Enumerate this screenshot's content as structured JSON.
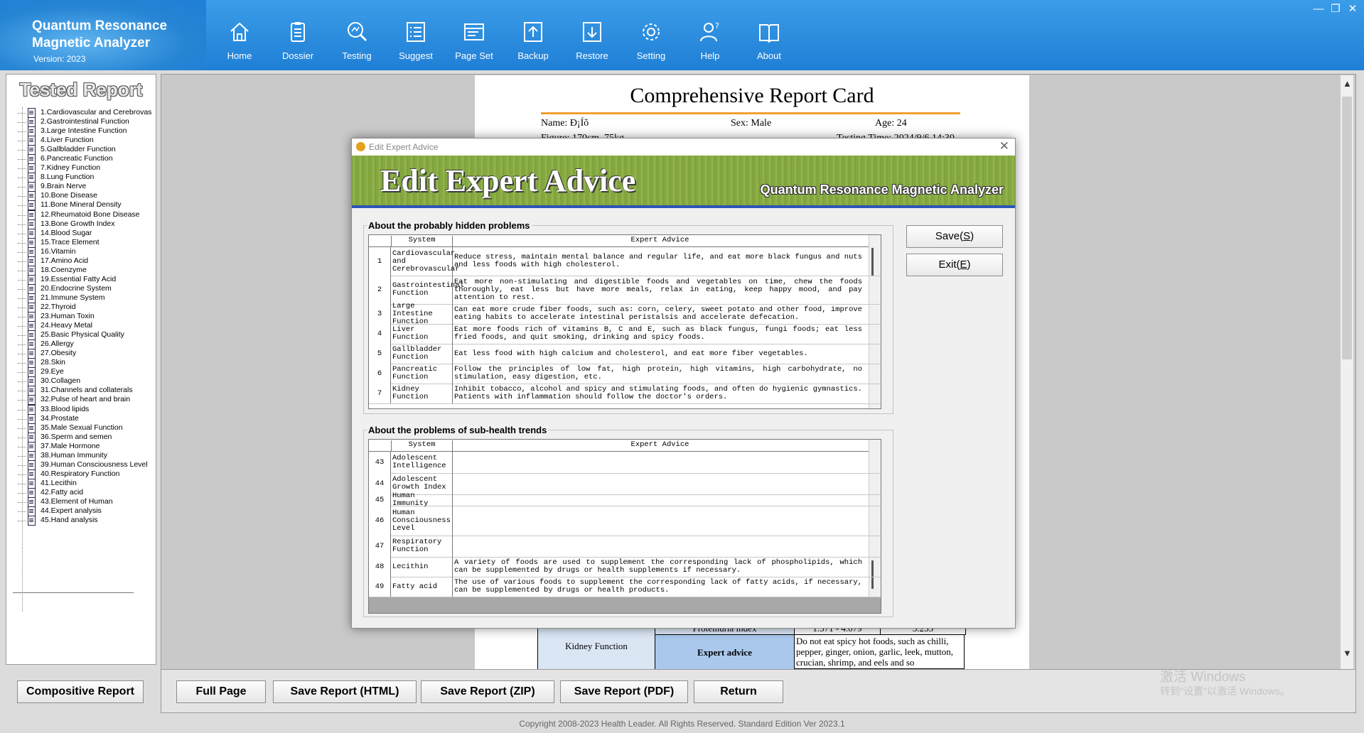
{
  "app": {
    "name_line1": "Quantum Resonance",
    "name_line2": "Magnetic Analyzer",
    "version": "Version: 2023"
  },
  "window_controls": {
    "minimize": "—",
    "restore": "❐",
    "close": "✕"
  },
  "nav": [
    {
      "label": "Home",
      "icon": "home-icon"
    },
    {
      "label": "Dossier",
      "icon": "dossier-icon"
    },
    {
      "label": "Testing",
      "icon": "testing-icon"
    },
    {
      "label": "Suggest",
      "icon": "suggest-icon"
    },
    {
      "label": "Page Set",
      "icon": "page-set-icon"
    },
    {
      "label": "Backup",
      "icon": "backup-icon"
    },
    {
      "label": "Restore",
      "icon": "restore-icon"
    },
    {
      "label": "Setting",
      "icon": "gear-icon"
    },
    {
      "label": "Help",
      "icon": "help-icon"
    },
    {
      "label": "About",
      "icon": "book-icon"
    }
  ],
  "sidebar": {
    "title": "Tested Report",
    "items": [
      "1.Cardiovascular and Cerebrovas",
      "2.Gastrointestinal Function",
      "3.Large Intestine Function",
      "4.Liver Function",
      "5.Gallbladder Function",
      "6.Pancreatic Function",
      "7.Kidney Function",
      "8.Lung Function",
      "9.Brain Nerve",
      "10.Bone Disease",
      "11.Bone Mineral Density",
      "12.Rheumatoid Bone Disease",
      "13.Bone Growth Index",
      "14.Blood Sugar",
      "15.Trace Element",
      "16.Vitamin",
      "17.Amino Acid",
      "18.Coenzyme",
      "19.Essential Fatty Acid",
      "20.Endocrine System",
      "21.Immune System",
      "22.Thyroid",
      "23.Human Toxin",
      "24.Heavy Metal",
      "25.Basic Physical Quality",
      "26.Allergy",
      "27.Obesity",
      "28.Skin",
      "29.Eye",
      "30.Collagen",
      "31.Channels and collaterals",
      "32.Pulse of heart and brain",
      "33.Blood lipids",
      "34.Prostate",
      "35.Male Sexual Function",
      "36.Sperm and semen",
      "37.Male Hormone",
      "38.Human Immunity",
      "39.Human Consciousness Level",
      "40.Respiratory Function",
      "41.Lecithin",
      "42.Fatty acid",
      "43.Element of Human",
      "44.Expert analysis",
      "45.Hand analysis"
    ],
    "composite_button": "Compositive Report"
  },
  "report": {
    "title": "Comprehensive Report Card",
    "name": "Name: Đ¡Íõ",
    "sex": "Sex: Male",
    "age": "Age: 24",
    "figure": "Figure: 170cm, 75kg",
    "testing_time": "Testing Time: 2024/9/6 14:30",
    "kidney": {
      "system": "Kidney Function",
      "row_label": "Proteinuria index",
      "range": "1.571 - 4.079",
      "value": "3.255",
      "expert_label": "Expert advice",
      "expert_text": "Do not eat spicy hot foods, such as chilli, pepper, ginger, onion, garlic, leek, mutton, crucian, shrimp, and eels and so"
    }
  },
  "bottom_buttons": [
    "Full Page",
    "Save Report (HTML)",
    "Save Report (ZIP)",
    "Save Report (PDF)",
    "Return"
  ],
  "copyright": "Copyright 2008-2023 Health Leader. All Rights Reserved.  Standard Edition Ver 2023.1",
  "watermark": {
    "line1": "激活 Windows",
    "line2": "转到\"设置\"以激活 Windows。"
  },
  "dialog": {
    "title": "Edit Expert Advice",
    "banner_title": "Edit Expert Advice",
    "banner_subtitle": "Quantum Resonance Magnetic Analyzer",
    "save_label": "Save(",
    "save_key": "S",
    "exit_label": "Exit(",
    "exit_key": "E",
    "close_paren": ")",
    "group1": {
      "title": "About the probably hidden problems",
      "col_system": "System",
      "col_advice": "Expert Advice",
      "rows": [
        {
          "n": "1",
          "system": "Cardiovascular and Cerebrovascular",
          "advice": "Reduce stress, maintain mental balance and regular life, and eat more black fungus and nuts and less foods with high cholesterol."
        },
        {
          "n": "2",
          "system": "Gastrointestinal Function",
          "advice": "Eat more non-stimulating and digestible foods and vegetables on time, chew the foods thoroughly, eat less but have more meals, relax in eating, keep happy mood, and pay attention to rest."
        },
        {
          "n": "3",
          "system": "Large Intestine Function",
          "advice": "Can eat more crude fiber foods, such as: corn, celery, sweet potato and other food, improve eating habits to accelerate intestinal peristalsis and accelerate defecation."
        },
        {
          "n": "4",
          "system": "Liver Function",
          "advice": "Eat more foods rich of vitamins B, C and E, such as black fungus, fungi foods; eat less fried foods, and quit smoking, drinking and spicy foods."
        },
        {
          "n": "5",
          "system": "Gallbladder Function",
          "advice": "Eat less food with high calcium and cholesterol, and eat more fiber vegetables."
        },
        {
          "n": "6",
          "system": "Pancreatic Function",
          "advice": "Follow the principles of low fat, high protein, high vitamins, high carbohydrate, no stimulation, easy digestion, etc."
        },
        {
          "n": "7",
          "system": "Kidney Function",
          "advice": "Inhibit tobacco, alcohol and spicy and stimulating foods, and often do hygienic gymnastics. Patients with inflammation should follow the doctor's orders."
        }
      ]
    },
    "group2": {
      "title": "About the problems of sub-health trends",
      "col_system": "System",
      "col_advice": "Expert Advice",
      "rows": [
        {
          "n": "43",
          "system": "Adolescent Intelligence",
          "advice": ""
        },
        {
          "n": "44",
          "system": "Adolescent Growth Index",
          "advice": ""
        },
        {
          "n": "45",
          "system": "Human Immunity",
          "advice": ""
        },
        {
          "n": "46",
          "system": "Human Consciousness Level",
          "advice": ""
        },
        {
          "n": "47",
          "system": "Respiratory Function",
          "advice": ""
        },
        {
          "n": "48",
          "system": "Lecithin",
          "advice": "A variety of foods are used to supplement the corresponding lack of phospholipids, which can be supplemented by drugs or health supplements if necessary."
        },
        {
          "n": "49",
          "system": "Fatty acid",
          "advice": "The use of various foods to supplement the corresponding lack of fatty acids, if necessary, can be supplemented by drugs or health products."
        }
      ]
    }
  }
}
